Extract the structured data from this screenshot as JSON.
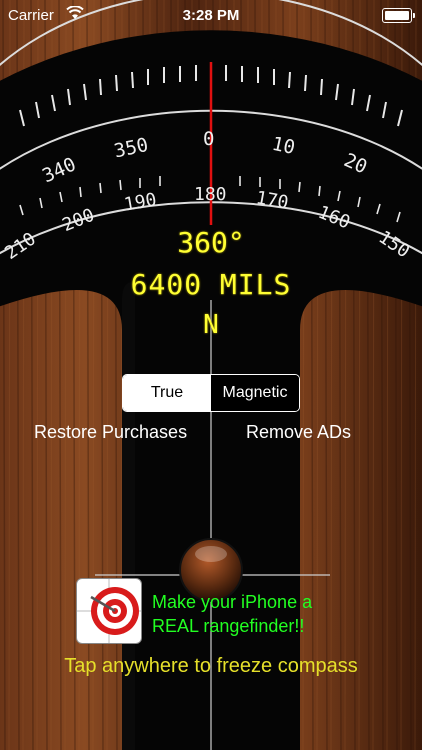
{
  "status_bar": {
    "carrier": "Carrier",
    "time": "3:28 PM"
  },
  "compass": {
    "outer_labels": [
      "0",
      "10",
      "20",
      "340",
      "350"
    ],
    "inner_labels": [
      "180",
      "170",
      "160",
      "150",
      "190",
      "200",
      "210"
    ],
    "degrees": "360°",
    "mils": "6400 MILS",
    "cardinal": "N"
  },
  "mode": {
    "options": [
      "True",
      "Magnetic"
    ],
    "selected": "True"
  },
  "links": {
    "restore": "Restore Purchases",
    "remove_ads": "Remove ADs"
  },
  "ad": {
    "line1": "Make your iPhone a",
    "line2": "REAL rangefinder!!"
  },
  "hint": "Tap anywhere to freeze compass",
  "colors": {
    "readout": "#ffff33",
    "ad_text": "#22ff22",
    "hint": "#e6e02a",
    "needle": "#e01010"
  }
}
